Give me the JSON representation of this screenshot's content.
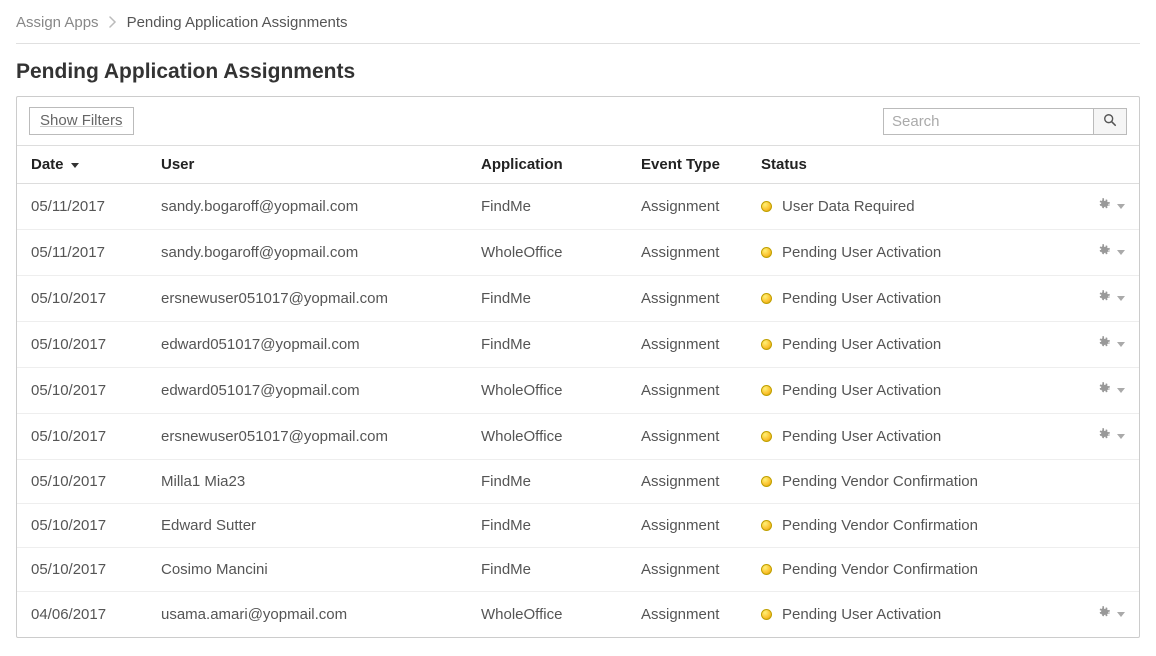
{
  "breadcrumb": {
    "parent": "Assign Apps",
    "current": "Pending Application Assignments"
  },
  "page_title": "Pending Application Assignments",
  "toolbar": {
    "show_filters_label": "Show Filters",
    "search_placeholder": "Search"
  },
  "table": {
    "headers": {
      "date": "Date",
      "user": "User",
      "application": "Application",
      "event_type": "Event Type",
      "status": "Status"
    },
    "rows": [
      {
        "date": "05/11/2017",
        "user": "sandy.bogaroff@yopmail.com",
        "application": "FindMe",
        "event_type": "Assignment",
        "status": "User Data Required",
        "actions": true
      },
      {
        "date": "05/11/2017",
        "user": "sandy.bogaroff@yopmail.com",
        "application": "WholeOffice",
        "event_type": "Assignment",
        "status": "Pending User Activation",
        "actions": true
      },
      {
        "date": "05/10/2017",
        "user": "ersnewuser051017@yopmail.com",
        "application": "FindMe",
        "event_type": "Assignment",
        "status": "Pending User Activation",
        "actions": true
      },
      {
        "date": "05/10/2017",
        "user": "edward051017@yopmail.com",
        "application": "FindMe",
        "event_type": "Assignment",
        "status": "Pending User Activation",
        "actions": true
      },
      {
        "date": "05/10/2017",
        "user": "edward051017@yopmail.com",
        "application": "WholeOffice",
        "event_type": "Assignment",
        "status": "Pending User Activation",
        "actions": true
      },
      {
        "date": "05/10/2017",
        "user": "ersnewuser051017@yopmail.com",
        "application": "WholeOffice",
        "event_type": "Assignment",
        "status": "Pending User Activation",
        "actions": true
      },
      {
        "date": "05/10/2017",
        "user": "Milla1 Mia23",
        "application": "FindMe",
        "event_type": "Assignment",
        "status": "Pending Vendor Confirmation",
        "actions": false
      },
      {
        "date": "05/10/2017",
        "user": "Edward Sutter",
        "application": "FindMe",
        "event_type": "Assignment",
        "status": "Pending Vendor Confirmation",
        "actions": false
      },
      {
        "date": "05/10/2017",
        "user": "Cosimo Mancini",
        "application": "FindMe",
        "event_type": "Assignment",
        "status": "Pending Vendor Confirmation",
        "actions": false
      },
      {
        "date": "04/06/2017",
        "user": "usama.amari@yopmail.com",
        "application": "WholeOffice",
        "event_type": "Assignment",
        "status": "Pending User Activation",
        "actions": true
      }
    ]
  }
}
